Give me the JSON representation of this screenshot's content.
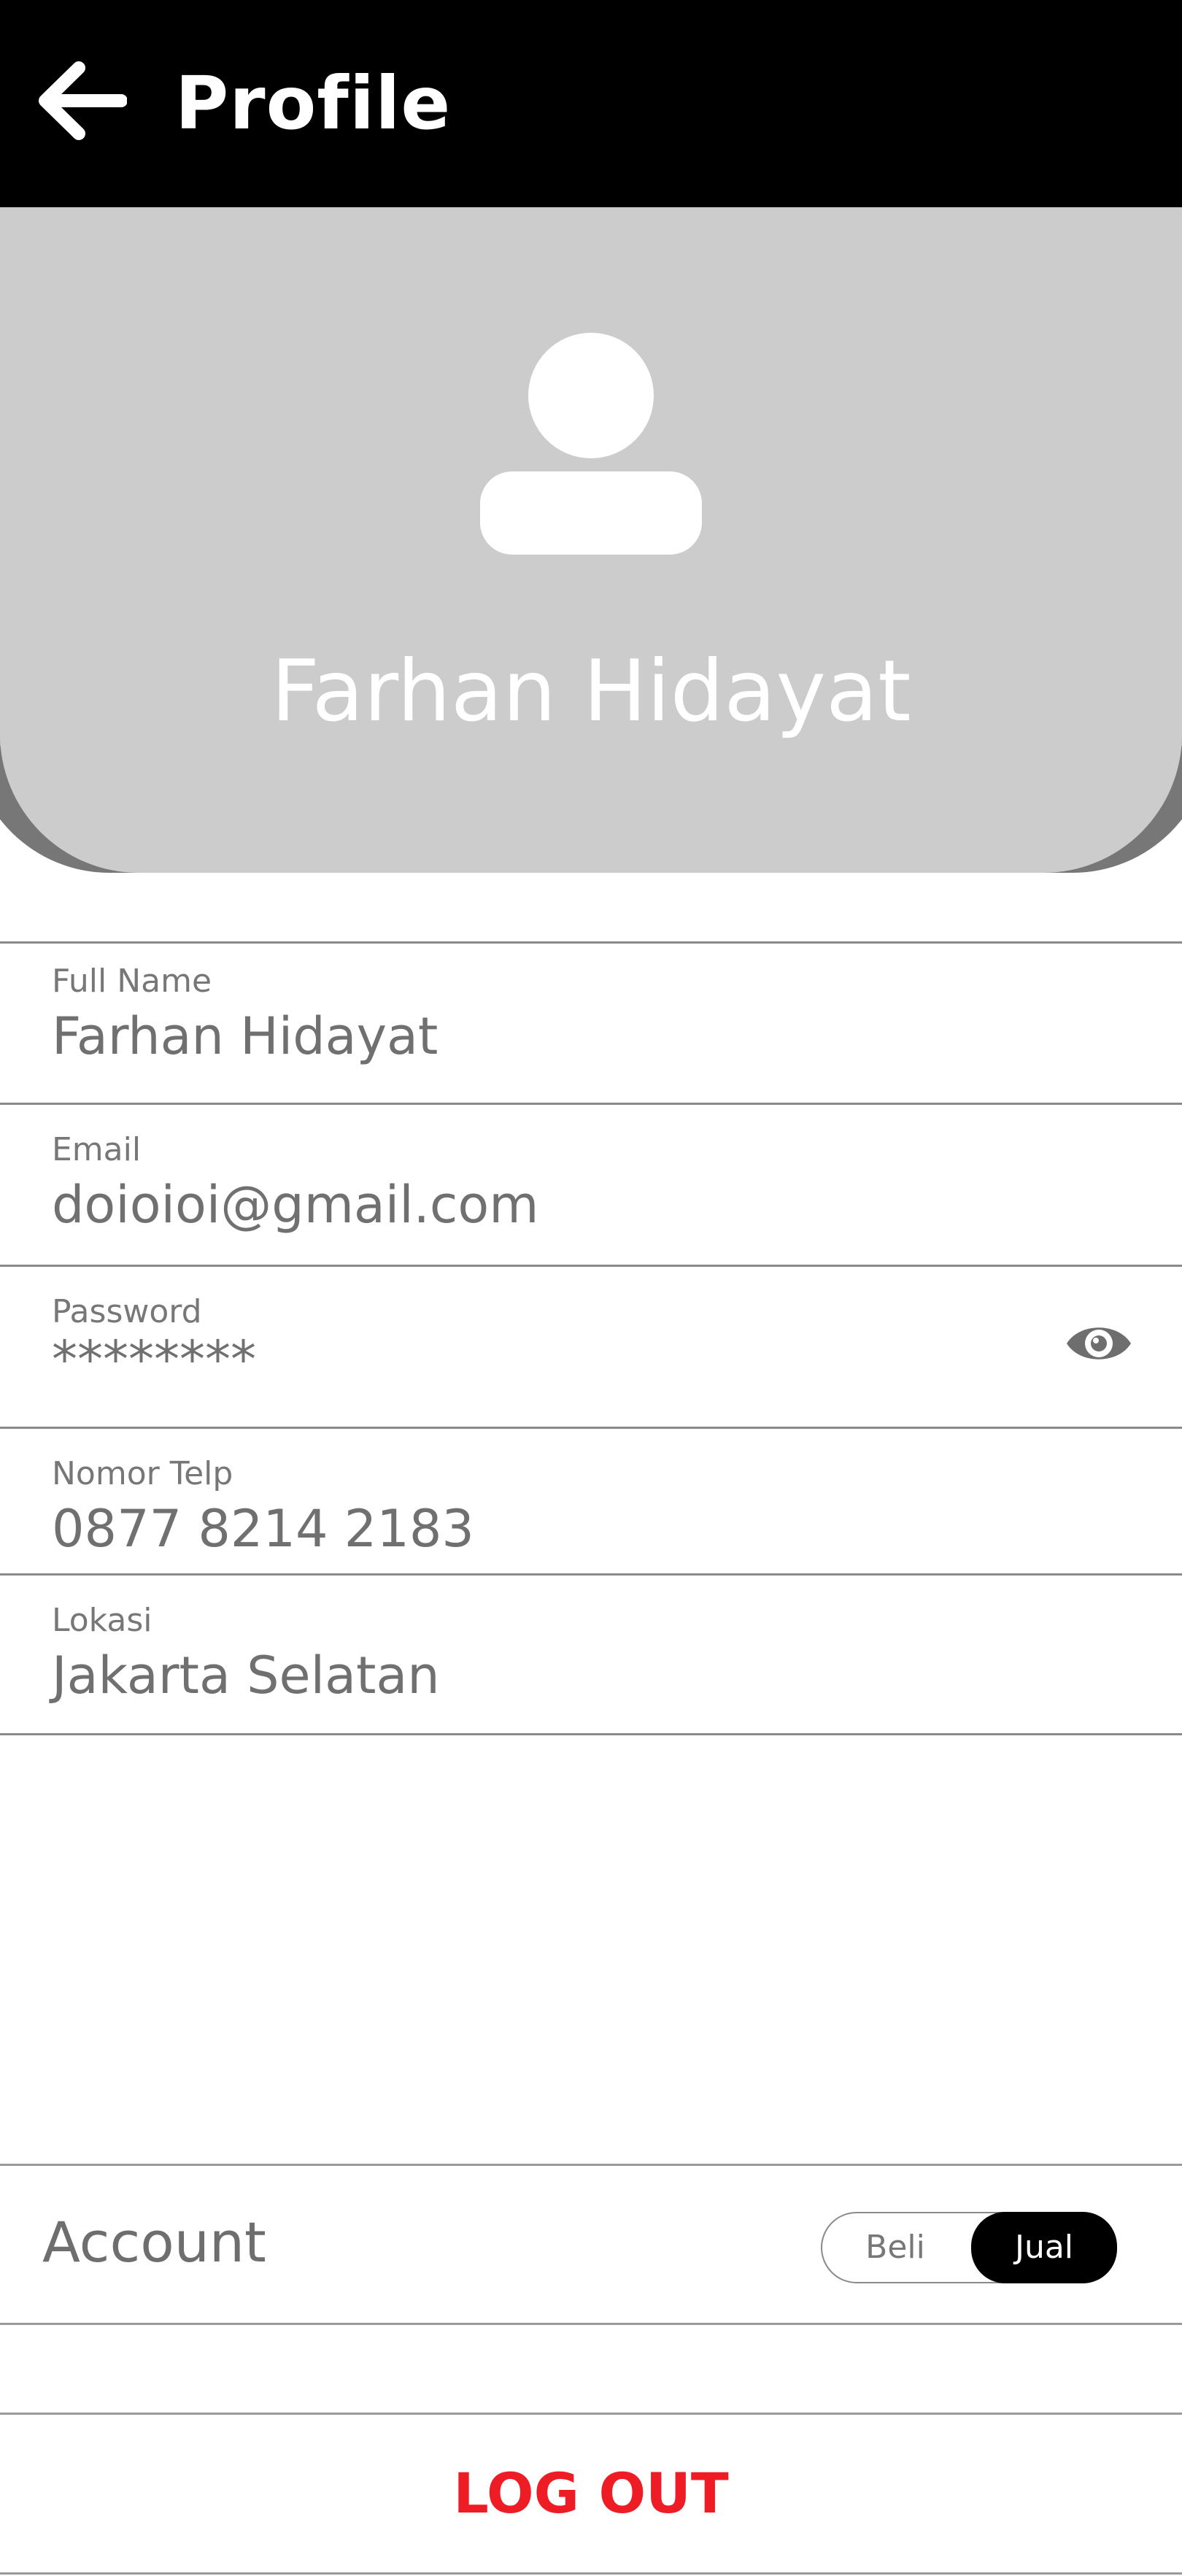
{
  "header": {
    "title": "Profile",
    "back_icon": "arrow-left-icon"
  },
  "profile": {
    "avatar_icon": "user-avatar-icon",
    "name": "Farhan Hidayat"
  },
  "fields": {
    "full_name": {
      "label": "Full Name",
      "value": "Farhan Hidayat"
    },
    "email": {
      "label": "Email",
      "value": "doioioi@gmail.com"
    },
    "password": {
      "label": "Password",
      "value": "********",
      "toggle_icon": "eye-icon"
    },
    "phone": {
      "label": "Nomor Telp",
      "value": "0877 8214 2183"
    },
    "location": {
      "label": "Lokasi",
      "value": "Jakarta Selatan"
    }
  },
  "account": {
    "label": "Account",
    "options": [
      "Beli",
      "Jual"
    ],
    "selected": "Jual"
  },
  "logout": {
    "label": "LOG OUT"
  },
  "colors": {
    "topbar": "#000000",
    "card": "#cccccc",
    "logout": "#ee1c24",
    "toggle_active": "#000000"
  }
}
